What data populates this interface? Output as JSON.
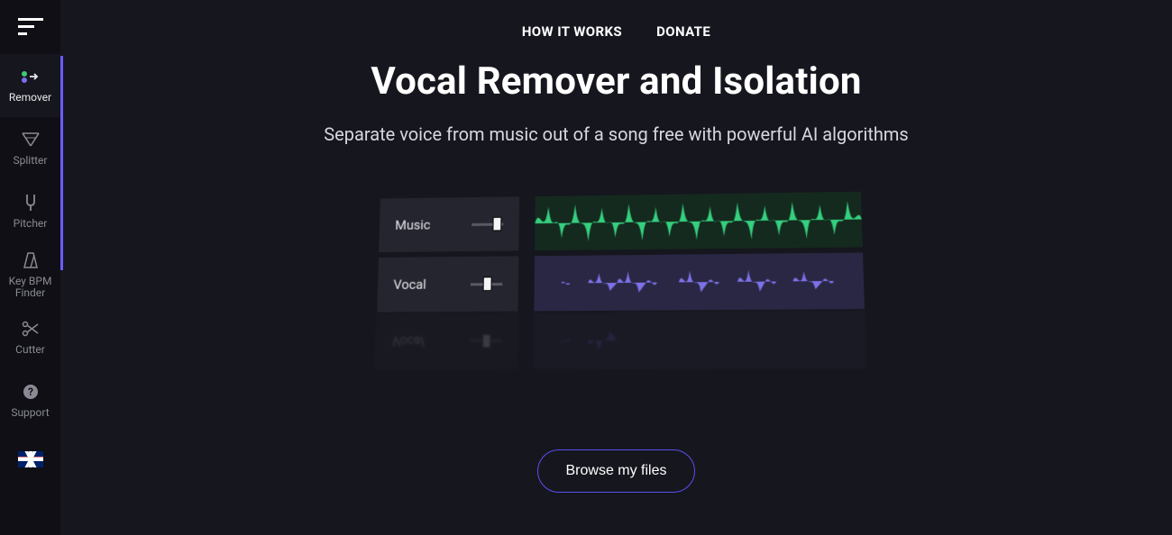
{
  "topnav": {
    "how_it_works": "HOW IT WORKS",
    "donate": "DONATE"
  },
  "hero": {
    "title": "Vocal Remover and Isolation",
    "subtitle": "Separate voice from music out of a song free with powerful AI algorithms"
  },
  "tracks": {
    "music_label": "Music",
    "vocal_label": "Vocal"
  },
  "actions": {
    "browse": "Browse my files"
  },
  "sidebar": {
    "items": [
      {
        "label": "Remover",
        "icon": "remover"
      },
      {
        "label": "Splitter",
        "icon": "splitter"
      },
      {
        "label": "Pitcher",
        "icon": "pitcher"
      },
      {
        "label": "Key BPM\nFinder",
        "icon": "metronome"
      },
      {
        "label": "Cutter",
        "icon": "scissors"
      },
      {
        "label": "Support",
        "icon": "help"
      }
    ]
  }
}
